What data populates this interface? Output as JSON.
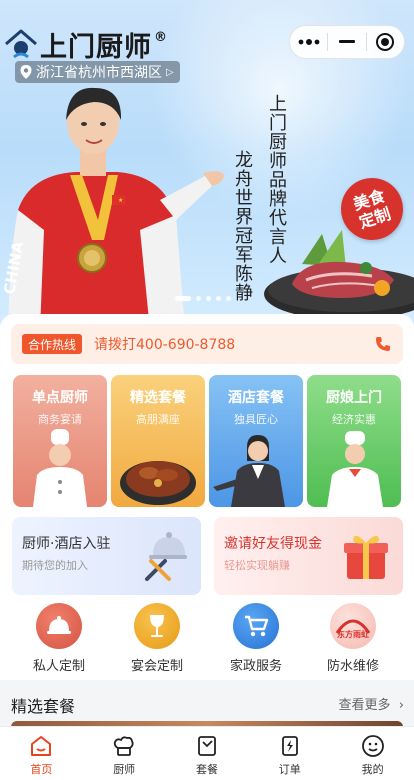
{
  "header": {
    "brand": "上门厨师",
    "registered_mark": "®",
    "location": "浙江省杭州市西湖区",
    "capsule": {
      "more_icon": "more-dots-icon",
      "minimize_icon": "minus-icon",
      "close_icon": "target-close-icon"
    }
  },
  "banner": {
    "slogan_line1": "上门厨师品牌代言人",
    "slogan_line2": "龙舟世界冠军陈静",
    "badge_line1": "美食",
    "badge_line2": "定制",
    "slides_total": 5,
    "active_slide": 1
  },
  "hotline": {
    "tag": "合作热线",
    "text": "请拨打400-690-8788"
  },
  "services": [
    {
      "title": "单点厨师",
      "subtitle": "商务宴请",
      "color": "#e58470"
    },
    {
      "title": "精选套餐",
      "subtitle": "高朋满座",
      "color": "#f1a93f"
    },
    {
      "title": "酒店套餐",
      "subtitle": "独具匠心",
      "color": "#4d96e6"
    },
    {
      "title": "厨娘上门",
      "subtitle": "经济实惠",
      "color": "#4fbe52"
    }
  ],
  "promos": [
    {
      "title": "厨师·酒店入驻",
      "subtitle": "期待您的加入"
    },
    {
      "title": "邀请好友得现金",
      "subtitle": "轻松实现躺赚"
    }
  ],
  "quick_links": [
    {
      "label": "私人定制",
      "icon": "cloche-icon"
    },
    {
      "label": "宴会定制",
      "icon": "wine-glass-icon"
    },
    {
      "label": "家政服务",
      "icon": "cart-icon"
    },
    {
      "label": "防水维修",
      "icon": "repair-brand-icon",
      "icon_text": "东方雨虹"
    }
  ],
  "section": {
    "title": "精选套餐",
    "more": "查看更多"
  },
  "tabbar": [
    {
      "label": "首页",
      "icon": "home-icon",
      "active": true
    },
    {
      "label": "厨师",
      "icon": "chef-hat-icon",
      "active": false
    },
    {
      "label": "套餐",
      "icon": "package-icon",
      "active": false
    },
    {
      "label": "订单",
      "icon": "order-icon",
      "active": false
    },
    {
      "label": "我的",
      "icon": "profile-smile-icon",
      "active": false
    }
  ],
  "colors": {
    "accent": "#e8431c",
    "hotline_bg": "#fdeee6",
    "badge_red": "#d8322c"
  }
}
